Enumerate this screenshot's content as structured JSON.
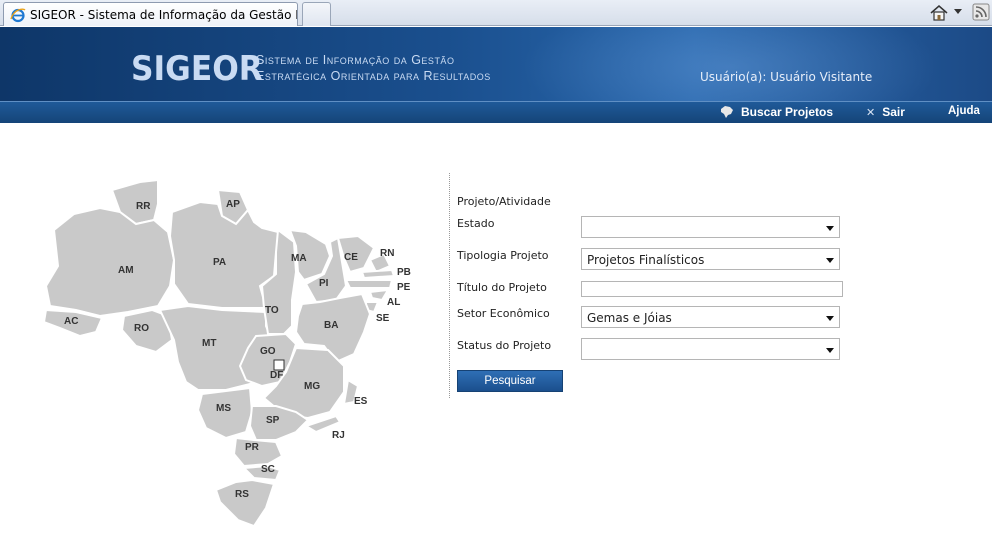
{
  "browser": {
    "tab_title": "SIGEOR - Sistema de Informação da Gestão Estrat..."
  },
  "header": {
    "logo": "SIGEOR",
    "subtitle_line1": "Sistema de Informação da Gestão",
    "subtitle_line2": "Estratégica Orientada para Resultados",
    "user": "Usuário(a): Usuário Visitante"
  },
  "nav": {
    "buscar": "Buscar Projetos",
    "sair": "Sair",
    "ajuda": "Ajuda"
  },
  "map": {
    "states": [
      "RR",
      "AP",
      "AM",
      "PA",
      "MA",
      "CE",
      "RN",
      "PB",
      "PE",
      "PI",
      "AL",
      "SE",
      "AC",
      "RO",
      "TO",
      "BA",
      "MT",
      "GO",
      "DF",
      "MG",
      "ES",
      "MS",
      "SP",
      "RJ",
      "PR",
      "SC",
      "RS"
    ]
  },
  "form": {
    "section_title": "Projeto/Atividade",
    "estado_label": "Estado",
    "estado_value": "",
    "tipologia_label": "Tipologia Projeto",
    "tipologia_value": "Projetos Finalísticos",
    "titulo_label": "Título do Projeto",
    "titulo_value": "",
    "setor_label": "Setor Econômico",
    "setor_value": "Gemas e Jóias",
    "status_label": "Status do Projeto",
    "status_value": "",
    "submit": "Pesquisar"
  },
  "colors": {
    "header": "#1a4f8e",
    "nav": "#1b4f8d",
    "map_fill": "#c9c9c9"
  }
}
